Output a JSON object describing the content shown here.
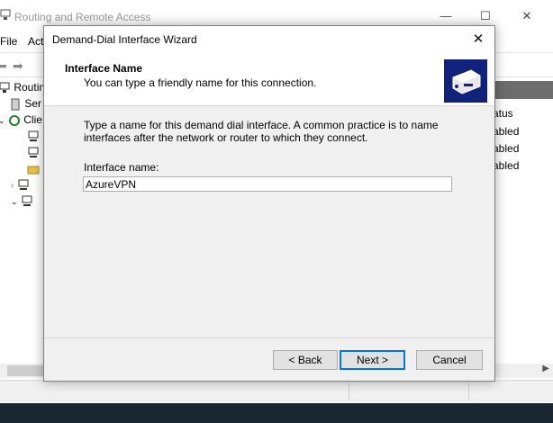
{
  "bg_window": {
    "title": "Routing and Remote Access",
    "minimize": "—",
    "maximize": "☐",
    "close": "✕"
  },
  "menu": {
    "file": "File",
    "action": "Act"
  },
  "tree": {
    "root": "Routin",
    "server": "Ser",
    "clients": "Clie"
  },
  "list": {
    "status_header": "atus",
    "rows": [
      "abled",
      "abled",
      "abled"
    ]
  },
  "dialog": {
    "title": "Demand-Dial Interface Wizard",
    "close_glyph": "✕",
    "header_title": "Interface Name",
    "header_subtitle": "You can type a friendly name for this connection.",
    "instructions": "Type a name for this demand dial interface.  A common practice is to name interfaces after the network or router to which they connect.",
    "field_label": "Interface name:",
    "field_value": "AzureVPN",
    "back": "< Back",
    "next": "Next >",
    "cancel": "Cancel"
  },
  "colors": {
    "header_icon_bg": "#10227a",
    "desktop": "#1a2733",
    "default_button_border": "#0078d7"
  }
}
